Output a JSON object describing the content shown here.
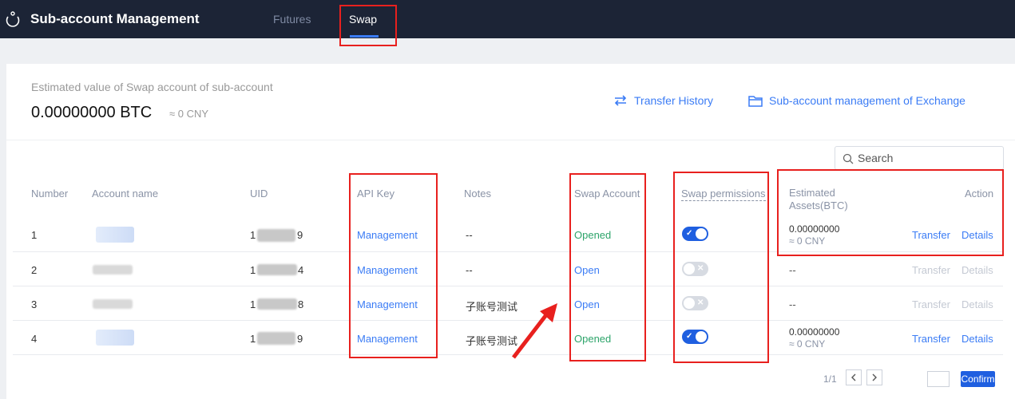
{
  "header": {
    "title": "Sub-account Management",
    "tabs": [
      {
        "label": "Futures",
        "active": false
      },
      {
        "label": "Swap",
        "active": true
      }
    ]
  },
  "summary": {
    "label": "Estimated value of Swap account of sub-account",
    "value": "0.00000000 BTC",
    "approx": "≈ 0 CNY",
    "transfer_history": "Transfer History",
    "exchange_link": "Sub-account management of Exchange"
  },
  "search": {
    "placeholder": "Search"
  },
  "table": {
    "headers": {
      "number": "Number",
      "account_name": "Account name",
      "uid": "UID",
      "api_key": "API Key",
      "notes": "Notes",
      "swap_account": "Swap Account",
      "swap_permissions": "Swap permissions",
      "estimated_assets": "Estimated Assets(BTC)",
      "action": "Action"
    },
    "rows": [
      {
        "number": "1",
        "uid_first": "1",
        "uid_last": "9",
        "api_key": "Management",
        "notes": "--",
        "swap_account": "Opened",
        "permission_on": true,
        "assets": "0.00000000",
        "assets_sub": "≈ 0 CNY",
        "transfer": "Transfer",
        "details": "Details"
      },
      {
        "number": "2",
        "uid_first": "1",
        "uid_last": "4",
        "api_key": "Management",
        "notes": "--",
        "swap_account": "Open",
        "permission_on": false,
        "assets": "--",
        "assets_sub": "",
        "transfer": "Transfer",
        "details": "Details"
      },
      {
        "number": "3",
        "uid_first": "1",
        "uid_last": "8",
        "api_key": "Management",
        "notes": "子账号测试",
        "swap_account": "Open",
        "permission_on": false,
        "assets": "--",
        "assets_sub": "",
        "transfer": "Transfer",
        "details": "Details"
      },
      {
        "number": "4",
        "uid_first": "1",
        "uid_last": "9",
        "api_key": "Management",
        "notes": "子账号测试",
        "swap_account": "Opened",
        "permission_on": true,
        "assets": "0.00000000",
        "assets_sub": "≈ 0 CNY",
        "transfer": "Transfer",
        "details": "Details"
      }
    ]
  },
  "pagination": {
    "info": "1/1",
    "confirm": "Confirm"
  },
  "colors": {
    "nav_bg": "#1c2436",
    "accent": "#3b7cf5",
    "opened": "#2da46a",
    "annotation": "#e8201e"
  }
}
